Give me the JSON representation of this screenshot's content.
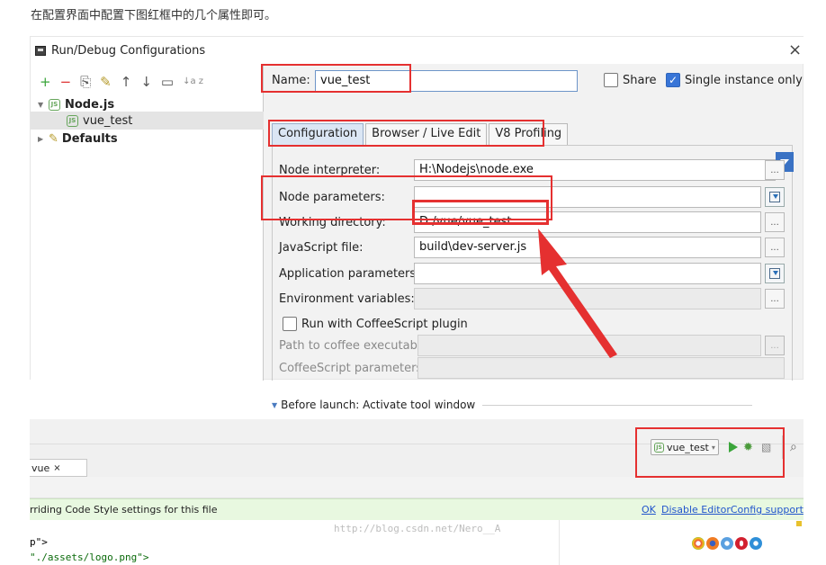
{
  "intro_text": "在配置界面中配置下图红框中的几个属性即可。",
  "dialog": {
    "title": "Run/Debug Configurations",
    "close": "×",
    "toolbar": [
      "+",
      "−",
      "⎘",
      "✎",
      "↑",
      "↓",
      "▭",
      "↓a z"
    ],
    "tree": {
      "nodejs": "Node.js",
      "child": "vue_test",
      "defaults": "Defaults"
    },
    "name_label": "Name:",
    "name_value": "vue_test",
    "share_label": "Share",
    "single_label": "Single instance only",
    "tabs": [
      "Configuration",
      "Browser / Live Edit",
      "V8 Profiling"
    ],
    "fields": {
      "node_interpreter": {
        "label": "Node interpreter:",
        "value": "H:\\Nodejs\\node.exe"
      },
      "node_parameters": {
        "label": "Node parameters:",
        "value": ""
      },
      "working_directory": {
        "label": "Working directory:",
        "value": "D:/vue/vue_test"
      },
      "javascript_file": {
        "label": "JavaScript file:",
        "value": "build\\dev-server.js"
      },
      "application_parameters": {
        "label": "Application parameters:",
        "value": ""
      },
      "environment_variables": {
        "label": "Environment variables:",
        "value": ""
      },
      "coffeescript_plugin": {
        "label": "Run with CoffeeScript plugin"
      },
      "path_to_coffee": {
        "label": "Path to coffee executable:",
        "value": ""
      },
      "coffeescript_parameters": {
        "label": "CoffeeScript parameters:",
        "value": ""
      }
    },
    "dots": "...",
    "before_launch": "Before launch: Activate tool window"
  },
  "ide": {
    "run_config": "vue_test",
    "file_tab": "vue",
    "file_tab_close": "×",
    "notice_text": "rriding Code Style settings for this file",
    "notice_ok": "OK",
    "notice_disable": "Disable EditorConfig support",
    "code_line1": "p\">",
    "code_line2": "\"./assets/logo.png\">",
    "watermark": "http://blog.csdn.net/Nero__A"
  },
  "colors": {
    "annotation_red": "#e53030",
    "selection_blue": "#3875d7",
    "notice_green": "#e8f8e0"
  }
}
